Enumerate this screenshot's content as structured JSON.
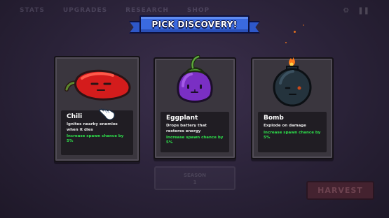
{
  "background_nav": {
    "items": [
      "STATS",
      "UPGRADES",
      "RESEARCH",
      "SHOP"
    ]
  },
  "banner": {
    "title": "PICK DISCOVERY!",
    "color": "#3a6ae0"
  },
  "cards": [
    {
      "name": "Chili",
      "icon": "chili-icon",
      "description": "Ignites nearby enemies when it dies",
      "bonus": "Increase spawn chance by 5%"
    },
    {
      "name": "Eggplant",
      "icon": "eggplant-icon",
      "description": "Drops battery that restores energy",
      "bonus": "Increase spawn chance by 5%"
    },
    {
      "name": "Bomb",
      "icon": "bomb-icon",
      "description": "Explode on damage",
      "bonus": "Increase spawn chance by 5%"
    }
  ],
  "bottom": {
    "center_label": "SEASON",
    "center_value": "1",
    "harvest_label": "HARVEST"
  },
  "cursor_icon": "pointing-hand-cursor-icon",
  "colors": {
    "bonus_text": "#2ee24b",
    "card_bg": "#3a363e"
  }
}
